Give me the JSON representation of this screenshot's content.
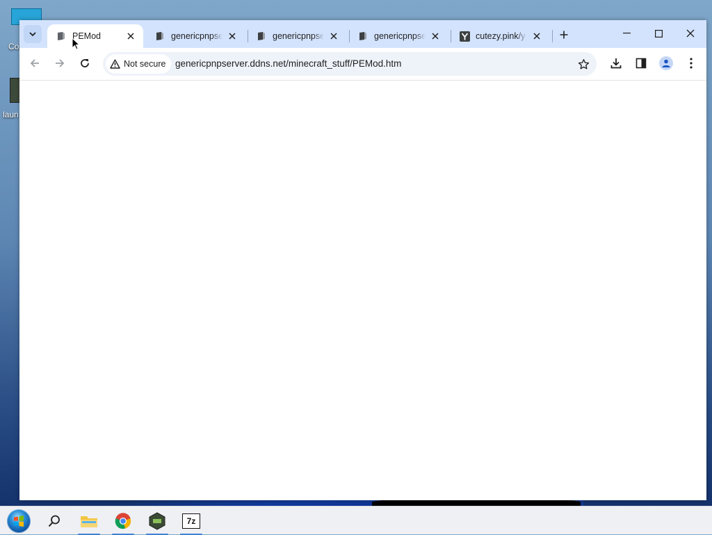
{
  "desktop": {
    "label_1": "Co",
    "label_2": "laun"
  },
  "browser": {
    "tabs": [
      {
        "title": "PEMod",
        "favicon": "file-page-icon",
        "active": true
      },
      {
        "title": "genericpnpserver",
        "favicon": "file-page-icon",
        "active": false
      },
      {
        "title": "genericpnpserver",
        "favicon": "file-page-icon",
        "active": false
      },
      {
        "title": "genericpnpserver",
        "favicon": "file-page-icon",
        "active": false
      },
      {
        "title": "cutezy.pink/y",
        "favicon": "y-logo-icon",
        "active": false
      }
    ],
    "security_label": "Not secure",
    "url": "genericpnpserver.ddns.net/minecraft_stuff/PEMod.htm"
  },
  "taskbar": {
    "items": [
      "start-orb",
      "search-icon",
      "file-explorer-icon",
      "chrome-icon",
      "minecraft-launcher-icon",
      "7zip-icon"
    ],
    "app_7zip_label": "7z"
  },
  "colors": {
    "tabstrip_bg": "#d3e3fd",
    "omnibox_bg": "#eef2f9",
    "taskbar_bg": "#eef0f3"
  }
}
